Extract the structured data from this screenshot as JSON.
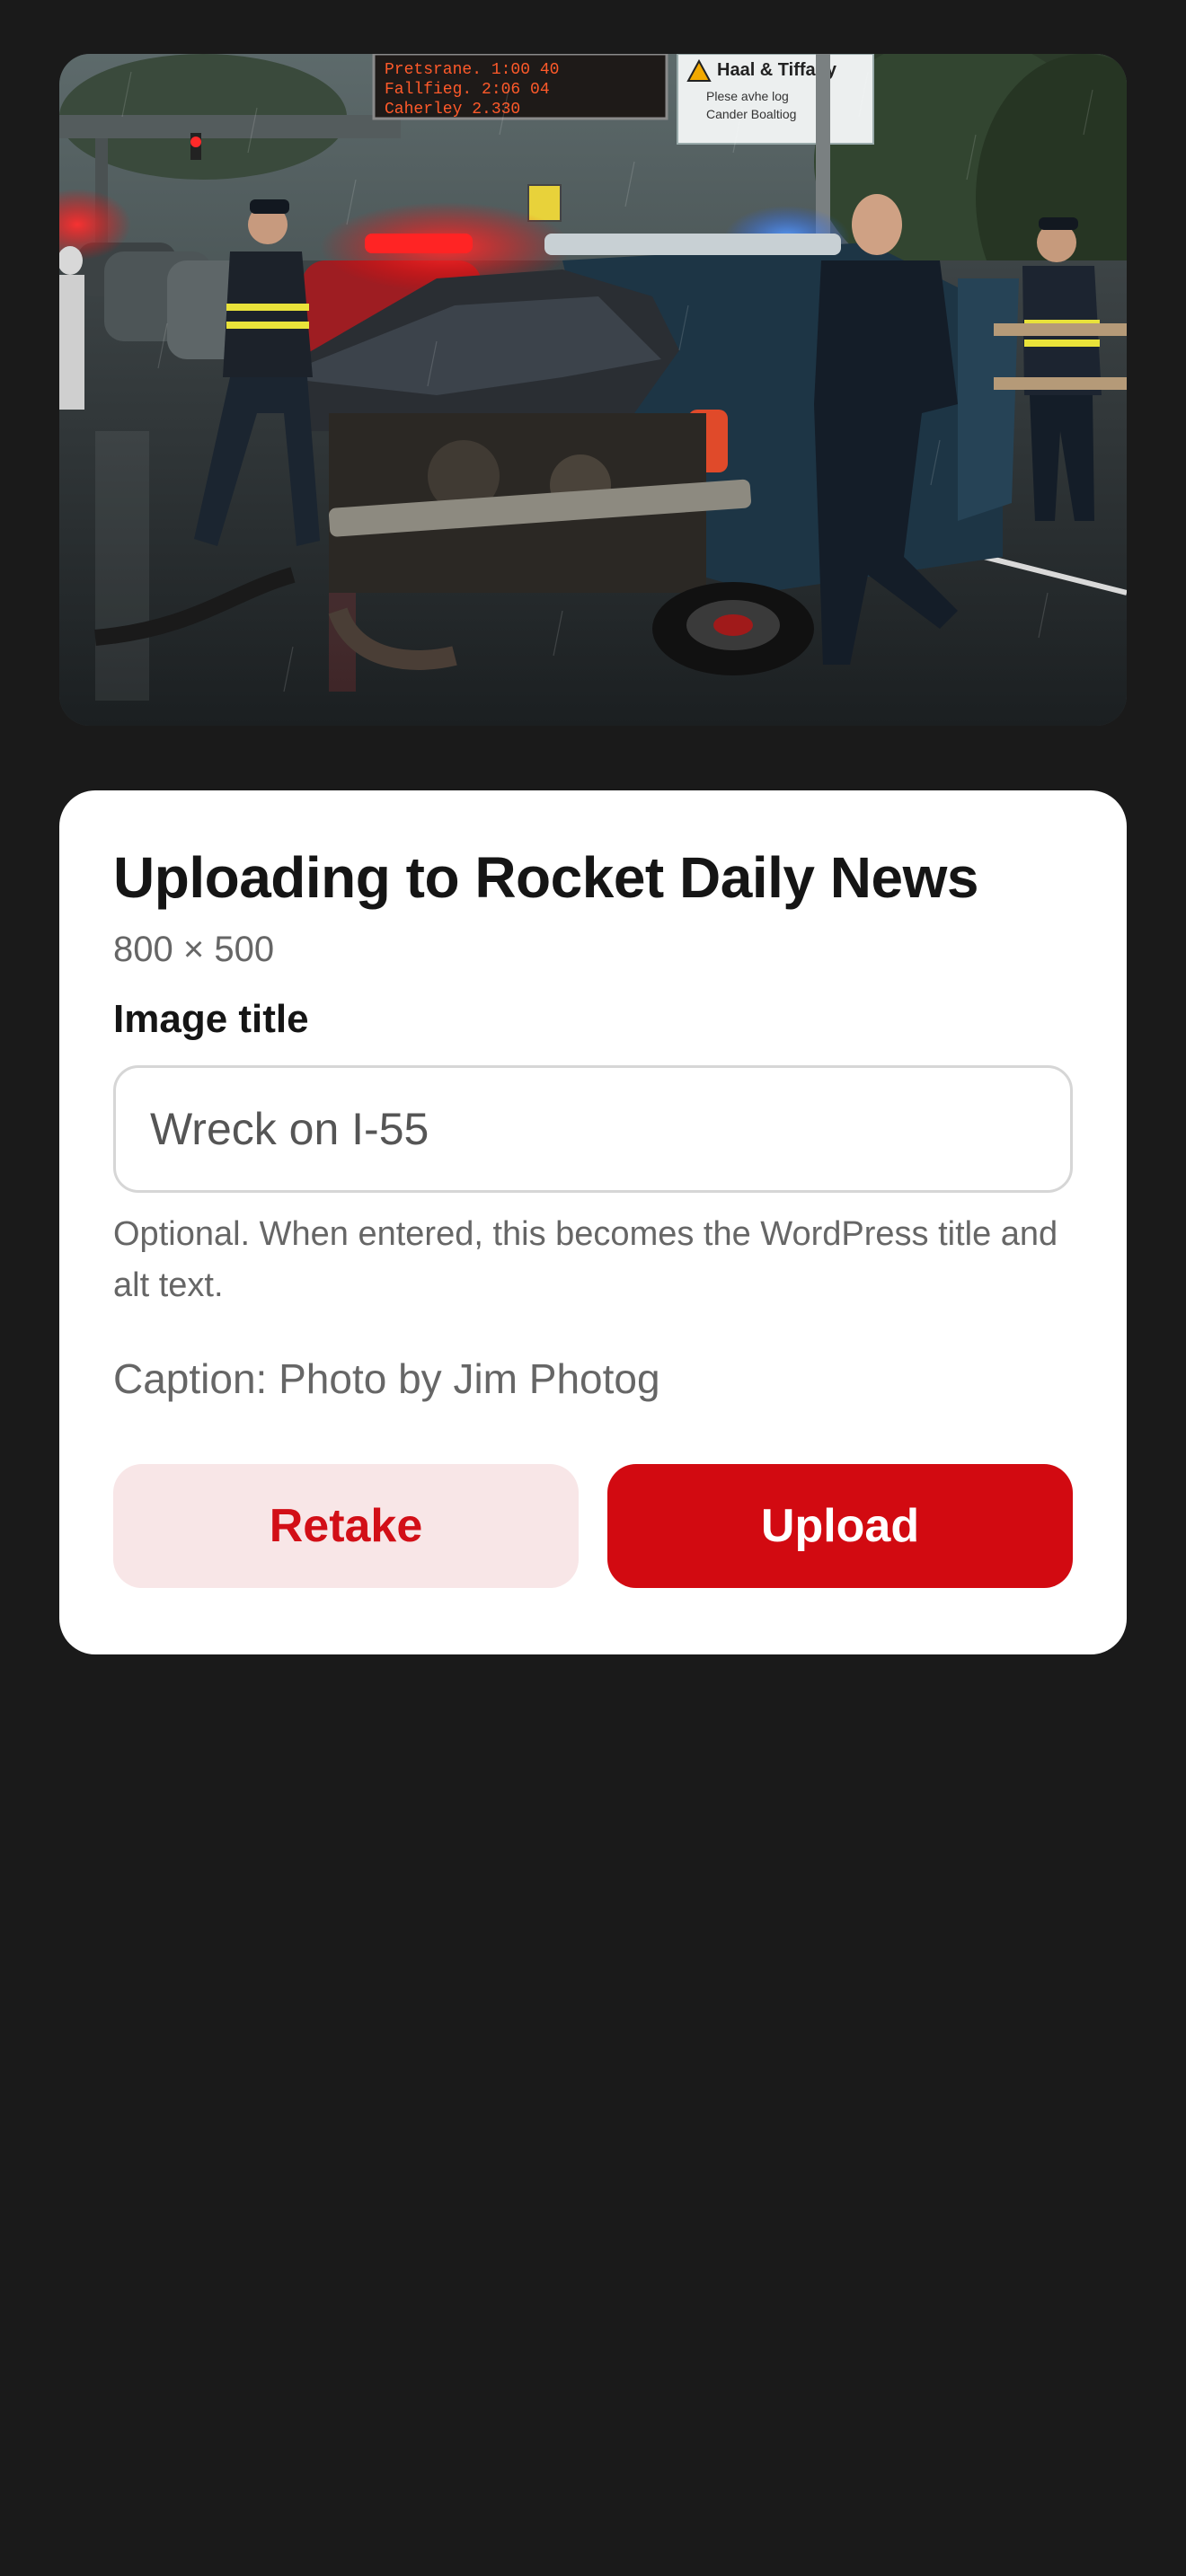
{
  "colors": {
    "background": "#1a1a1a",
    "card": "#ffffff",
    "accent": "#d20a11",
    "accent_light": "#f8e6e7"
  },
  "photo": {
    "sign_board_lines": [
      "Pretsrane.  1:00 40",
      "Fallfieg.   2:06 04",
      "Caherley    2.330"
    ],
    "road_sign_title": "Haal & Tiffany",
    "road_sign_lines": [
      "Plese avhe log",
      "Cander Boaltiog"
    ]
  },
  "upload": {
    "title": "Uploading to Rocket Daily News",
    "dimensions": "800 × 500",
    "field_label": "Image title",
    "field_value": "Wreck on I-55",
    "help_text": "Optional. When entered, this becomes the WordPress title and alt text.",
    "caption": "Caption: Photo by Jim Photog",
    "retake_label": "Retake",
    "upload_label": "Upload"
  }
}
